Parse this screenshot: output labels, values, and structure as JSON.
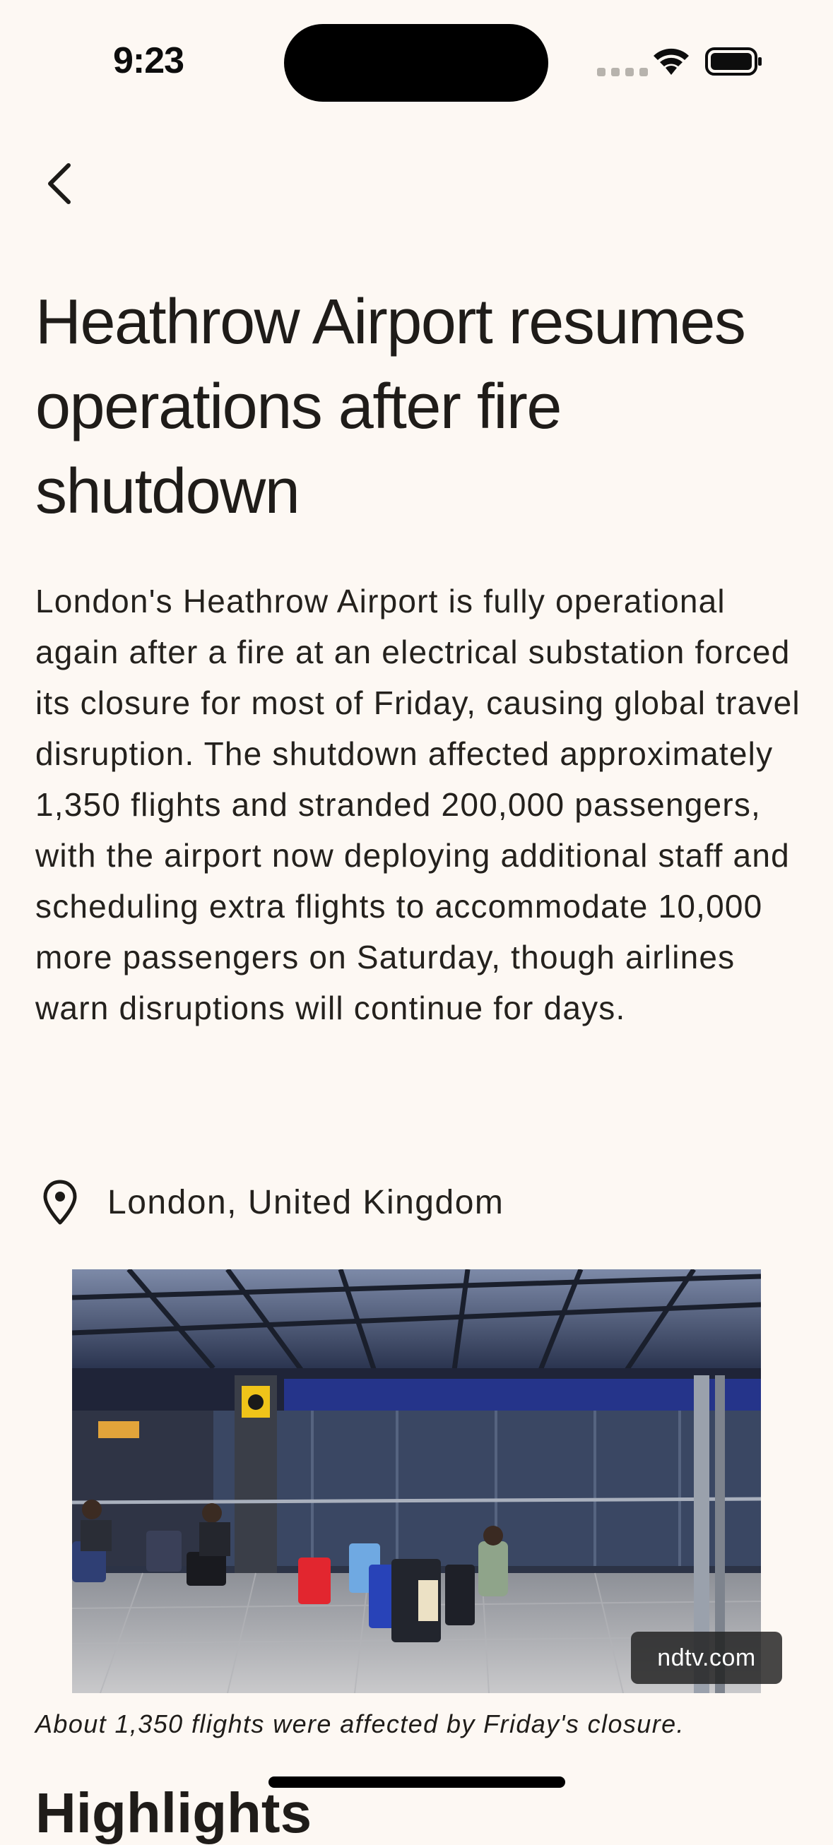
{
  "status_bar": {
    "time": "9:23",
    "icons": [
      "cellular-signal-icon",
      "wifi-icon",
      "battery-icon"
    ]
  },
  "navigation": {
    "back_icon": "chevron-left-icon"
  },
  "article": {
    "title": "Heathrow Airport resumes operations after fire shutdown",
    "summary": "London's Heathrow Airport is fully operational again after a fire at an electrical substation forced its closure for most of Friday, causing global travel disruption. The shutdown affected approximately 1,350 flights and stranded 200,000 passengers, with the airport now deploying additional staff and scheduling extra flights to accommodate 10,000 more passengers on Saturday, though airlines warn disruptions will continue for days.",
    "location": {
      "icon": "location-pin-icon",
      "text": "London, United Kingdom"
    },
    "image": {
      "source": "ndtv.com",
      "caption": "About 1,350 flights were affected by Friday's closure."
    },
    "next_section_heading": "Highlights"
  },
  "colors": {
    "background": "#fdf8f3",
    "text": "#1f1c19"
  }
}
